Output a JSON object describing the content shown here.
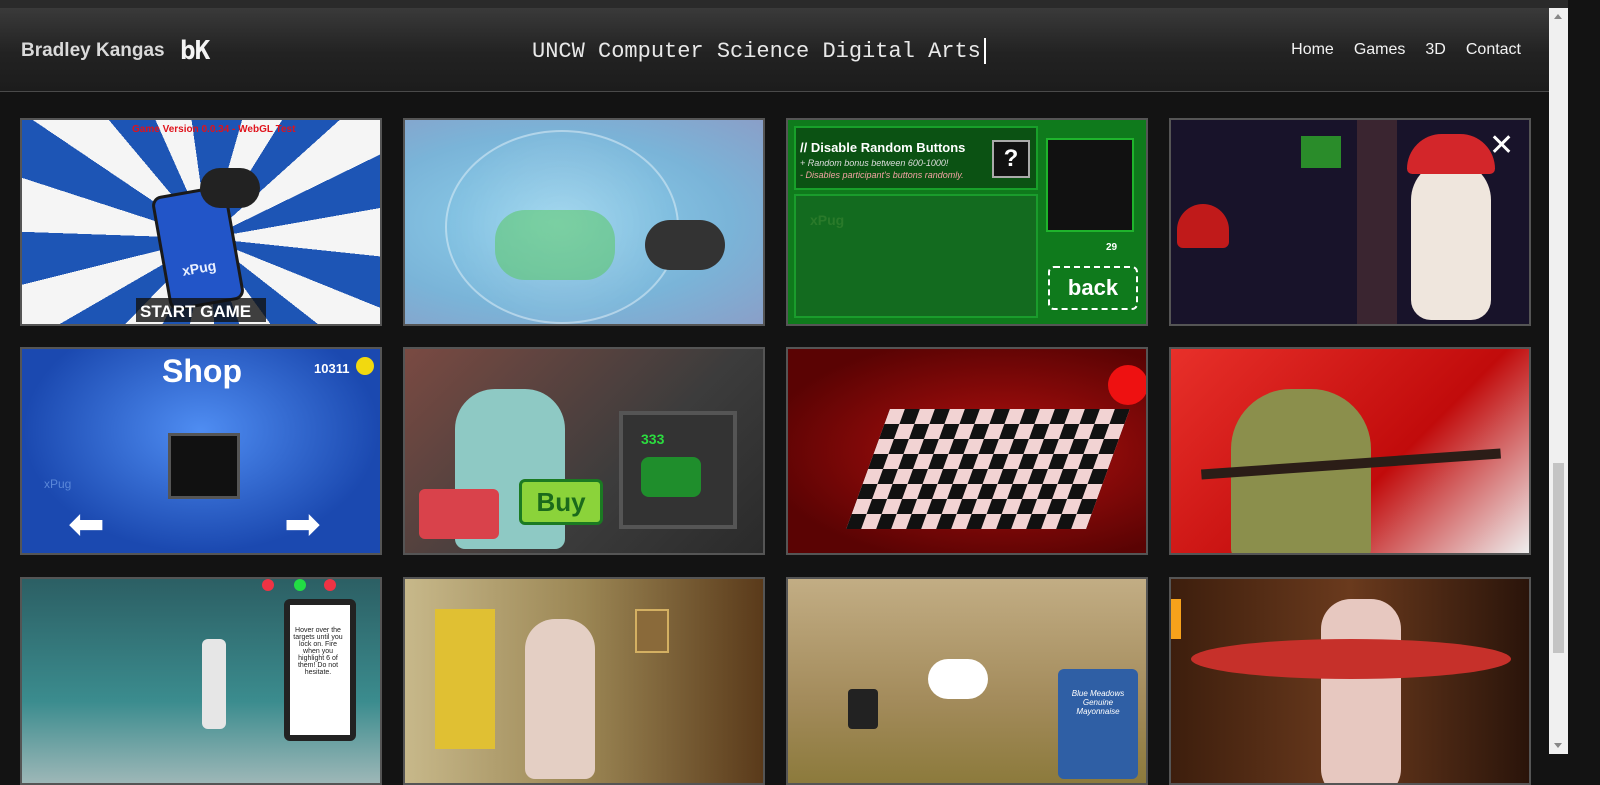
{
  "header": {
    "brand": "Bradley Kangas",
    "logo_text": "bK",
    "title": "UNCW Computer Science Digital Arts"
  },
  "nav": {
    "items": [
      "Home",
      "Games",
      "3D",
      "Contact"
    ]
  },
  "tiles": {
    "t1": {
      "version": "Game Version 0.0.34 - WebGL Test",
      "pug_label": "xPug",
      "cta": "START GAME"
    },
    "t3": {
      "title": "// Disable Random Buttons",
      "line1": "+ Random bonus between 600-1000!",
      "line2": "- Disables participant's buttons randomly.",
      "watermark": "xPug",
      "count": "29",
      "back": "back",
      "question": "?"
    },
    "t5": {
      "title": "Shop",
      "coins": "10311",
      "watermark": "xPug"
    },
    "t6": {
      "price": "333",
      "buy": "Buy"
    },
    "t9": {
      "hint": "Hover over the targets until you lock on. Fire when you highlight 6 of them! Do not hesitate."
    },
    "t11": {
      "jar": "Blue Meadows Genuine Mayonnaise"
    }
  },
  "colors": {
    "accent_blue": "#1d55b5",
    "shop_green": "#27c13a",
    "nav_text": "#f2f2f2",
    "background": "#131313"
  }
}
